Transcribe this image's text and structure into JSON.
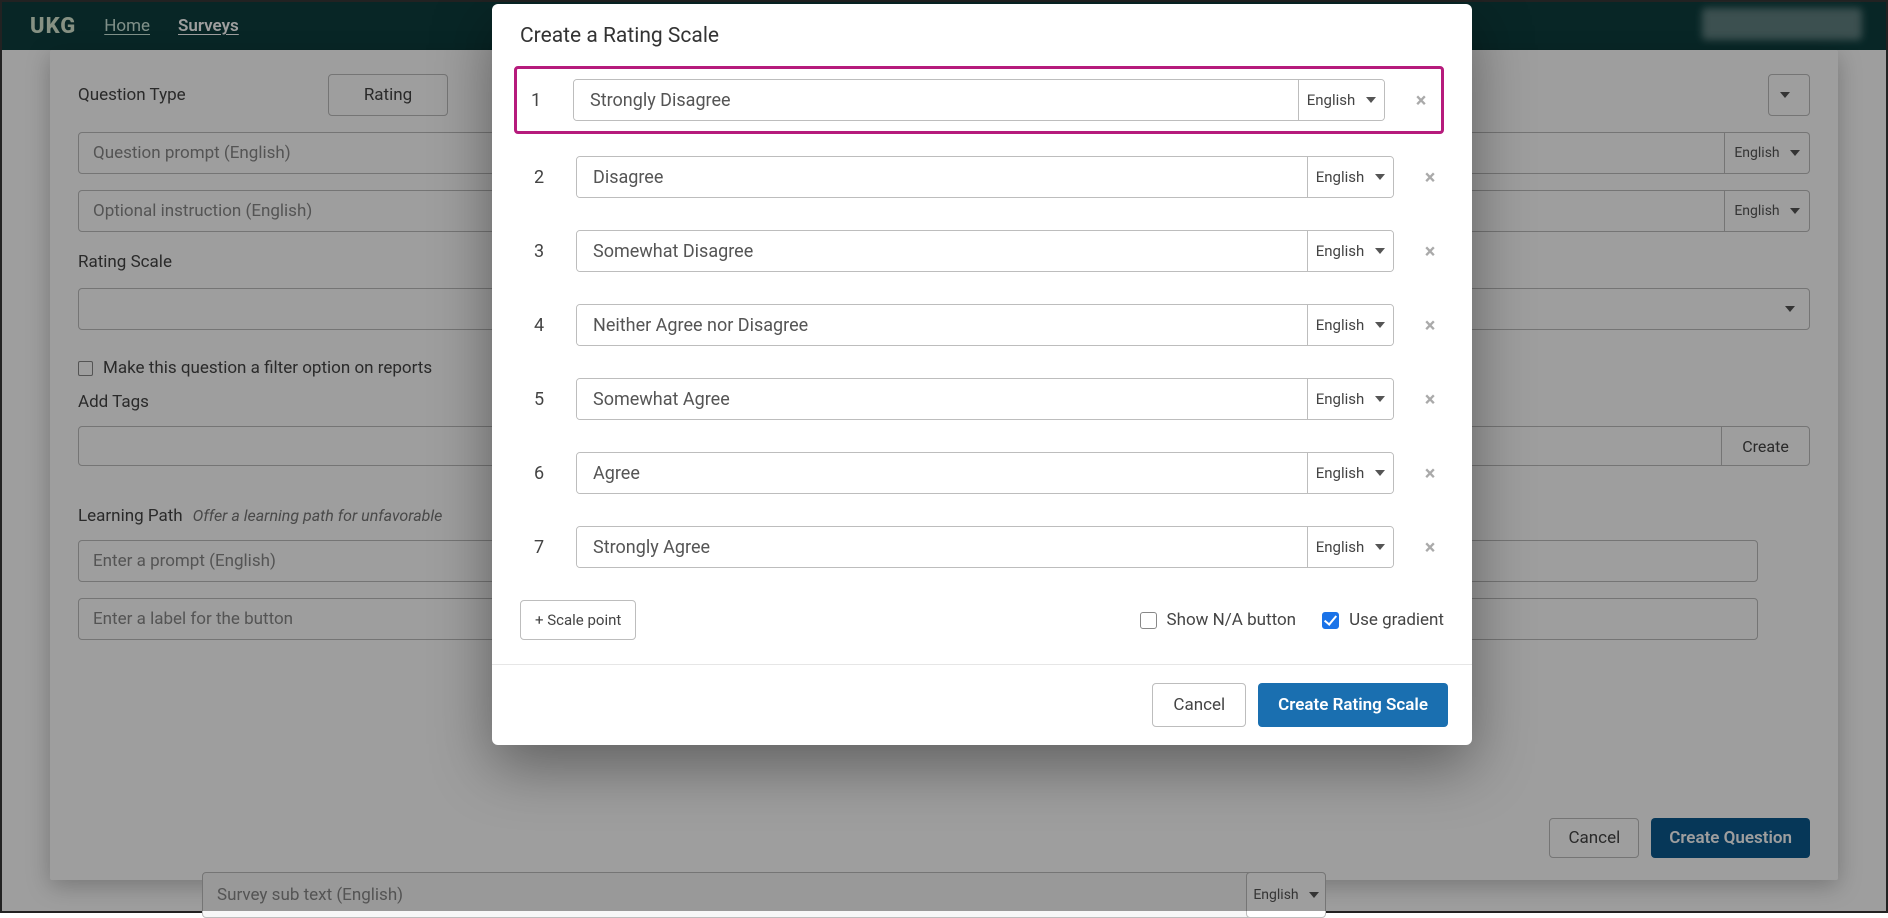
{
  "nav": {
    "brand": "UKG",
    "links": [
      "Home",
      "Surveys"
    ]
  },
  "bg": {
    "question_type_label": "Question Type",
    "question_type_value": "Rating",
    "question_prompt_placeholder": "Question prompt (English)",
    "optional_instruction_placeholder": "Optional instruction (English)",
    "rating_scale_label": "Rating Scale",
    "filter_checkbox_label": "Make this question a filter option on reports",
    "add_tags_label": "Add Tags",
    "tags_create": "Create",
    "learning_path_label": "Learning Path",
    "learning_path_sub": "Offer a learning path for unfavorable",
    "lp_prompt_placeholder": "Enter a prompt (English)",
    "lp_button_placeholder": "Enter a label for the button",
    "cancel": "Cancel",
    "create_question": "Create Question",
    "lang": "English",
    "survey_subtext_placeholder": "Survey sub text (English)"
  },
  "modal": {
    "title": "Create a Rating Scale",
    "lang": "English",
    "scale_points": [
      {
        "n": "1",
        "label": "Strongly Disagree"
      },
      {
        "n": "2",
        "label": "Disagree"
      },
      {
        "n": "3",
        "label": "Somewhat Disagree"
      },
      {
        "n": "4",
        "label": "Neither Agree nor Disagree"
      },
      {
        "n": "5",
        "label": "Somewhat Agree"
      },
      {
        "n": "6",
        "label": "Agree"
      },
      {
        "n": "7",
        "label": "Strongly Agree"
      }
    ],
    "add_scale_point": "+ Scale point",
    "show_na": "Show N/A button",
    "use_gradient": "Use gradient",
    "use_gradient_checked": true,
    "cancel": "Cancel",
    "create": "Create Rating Scale"
  }
}
